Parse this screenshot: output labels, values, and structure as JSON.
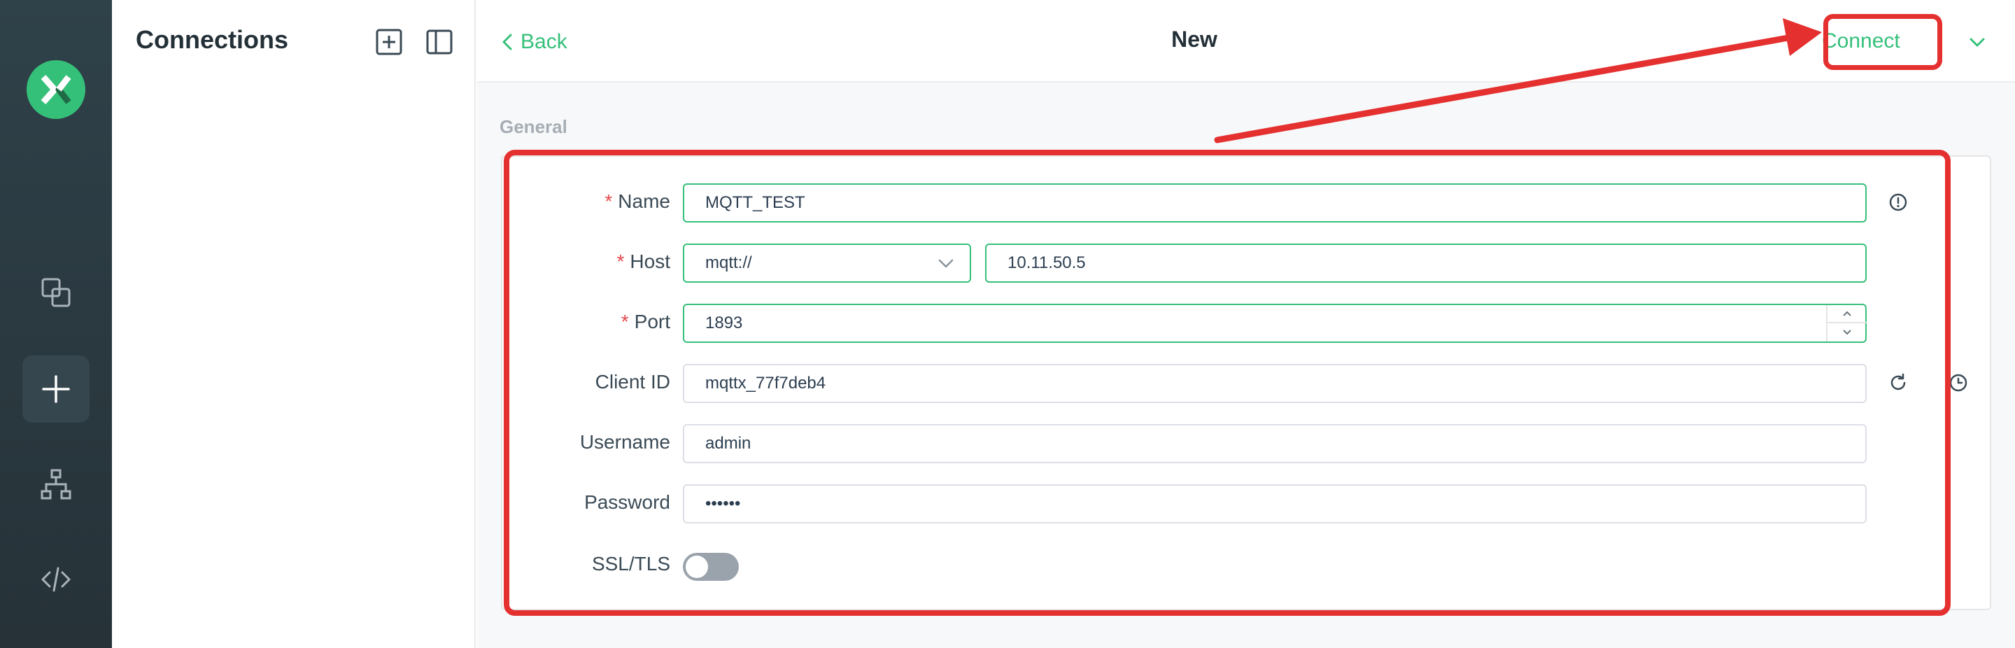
{
  "colors": {
    "accent": "#35c07a",
    "rail": "#263238",
    "highlight": "#e53030",
    "required": "#e5484d"
  },
  "rail": {
    "logo_icon": "mqttx-logo-icon",
    "items": [
      {
        "icon": "connections-icon"
      },
      {
        "icon": "plus-icon",
        "active": true
      },
      {
        "icon": "network-tree-icon"
      },
      {
        "icon": "code-icon"
      }
    ]
  },
  "connections_panel": {
    "title": "Connections",
    "new_icon": "add-square-icon",
    "toggle_icon": "sidebar-toggle-icon"
  },
  "header": {
    "back_label": "Back",
    "title": "New",
    "connect_label": "Connect",
    "more_icon": "chevron-down-icon"
  },
  "general": {
    "section_label": "General",
    "name": {
      "label": "Name",
      "required": "*",
      "value": "MQTT_TEST"
    },
    "host": {
      "label": "Host",
      "required": "*",
      "protocol": "mqtt://",
      "value": "10.11.50.5"
    },
    "port": {
      "label": "Port",
      "required": "*",
      "value": "1893"
    },
    "client_id": {
      "label": "Client ID",
      "value": "mqttx_77f7deb4"
    },
    "username": {
      "label": "Username",
      "value": "admin"
    },
    "password": {
      "label": "Password",
      "value": "••••••"
    },
    "ssl_tls": {
      "label": "SSL/TLS",
      "enabled": false
    }
  }
}
